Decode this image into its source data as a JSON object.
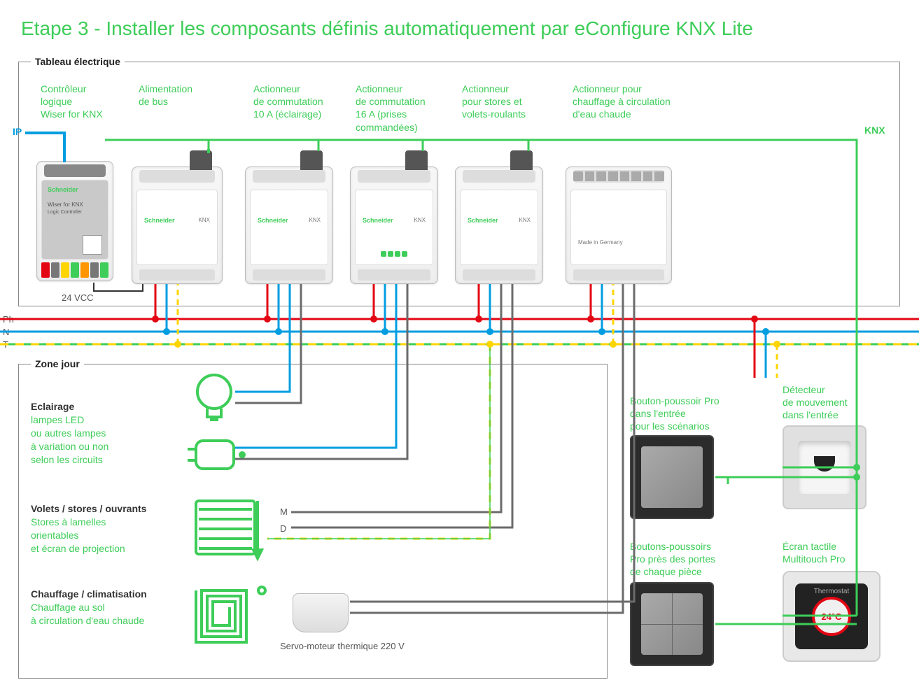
{
  "title": "Etape 3 - Installer les composants définis automatiquement par eConfigure KNX Lite",
  "panels": {
    "electrical": "Tableau électrique",
    "dayzone": "Zone jour"
  },
  "components": {
    "c1": "Contrôleur\nlogique\nWiser for KNX",
    "c2": "Alimentation\nde bus",
    "c3": "Actionneur\nde commutation\n10 A (éclairage)",
    "c4": "Actionneur\nde commutation\n16 A (prises\ncommandées)",
    "c5": "Actionneur\npour stores et\nvolets-roulants",
    "c6": "Actionneur pour\nchauffage à circulation\nd'eau chaude"
  },
  "buses": {
    "ip": "IP",
    "knx": "KNX",
    "supply": "24 VCC"
  },
  "mains": {
    "ph": "Ph",
    "n": "N",
    "t": "T"
  },
  "zone": {
    "lighting_head": "Eclairage",
    "lighting_body": "lampes LED\nou autres lampes\nà variation ou non\nselon les circuits",
    "blinds_head": "Volets / stores / ouvrants",
    "blinds_body": "Stores à lamelles\norientables\net écran de projection",
    "heating_head": "Chauffage / climatisation",
    "heating_body": "Chauffage au sol\nà circulation d'eau chaude",
    "motor_m": "M",
    "motor_d": "D",
    "servo": "Servo-moteur thermique 220 V"
  },
  "wall_devices": {
    "pb_entry": "Bouton-poussoir Pro\ndans l'entrée\npour les scénarios",
    "pb_rooms": "Boutons-poussoirs\nPro près des portes\nde chaque pièce",
    "motion": "Détecteur\nde mouvement\ndans l'entrée",
    "touch": "Écran tactile\nMultitouch Pro",
    "thermo_label": "Thermostat",
    "thermo_value": "24°C"
  },
  "colors": {
    "green": "#3dcd58",
    "red": "#e30613",
    "blue": "#009de0",
    "yellow": "#ffd500",
    "grey": "#6b6b6b"
  }
}
